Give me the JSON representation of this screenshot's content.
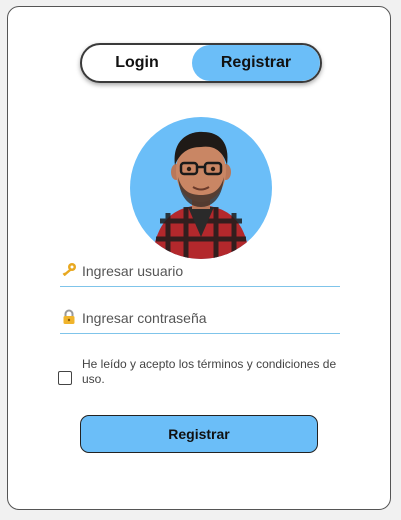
{
  "colors": {
    "accent": "#6bbef8",
    "underline": "#7fc4ea",
    "background": "#f1f1f1"
  },
  "toggle": {
    "login_label": "Login",
    "register_label": "Registrar",
    "active": "register"
  },
  "avatar": {
    "icon": "avatar-cartoon-man-icon"
  },
  "form": {
    "username": {
      "icon": "key-icon",
      "placeholder": "Ingresar usuario",
      "value": ""
    },
    "password": {
      "icon": "lock-icon",
      "placeholder": "Ingresar contraseña",
      "value": ""
    },
    "terms": {
      "label": "He leído y acepto los términos y condiciones de uso.",
      "checked": false
    },
    "submit_label": "Registrar"
  }
}
